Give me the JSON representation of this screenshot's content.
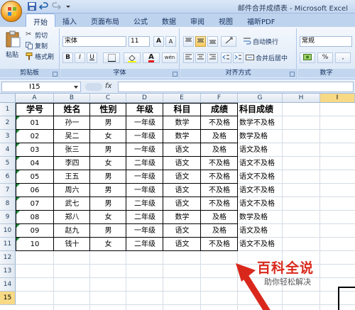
{
  "window": {
    "title": "邮件合并成绩表 - Microsoft Excel"
  },
  "ribbon": {
    "tabs": [
      "开始",
      "插入",
      "页面布局",
      "公式",
      "数据",
      "审阅",
      "视图",
      "福昕PDF"
    ],
    "active_tab": "开始",
    "clipboard": {
      "paste": "粘贴",
      "cut": "剪切",
      "copy": "复制",
      "format_painter": "格式刷",
      "label": "剪贴板"
    },
    "font": {
      "name": "宋体",
      "size": "11",
      "grow": "A",
      "shrink": "A",
      "bold": "B",
      "italic": "I",
      "underline": "U",
      "phonetic": "wén",
      "label": "字体"
    },
    "alignment": {
      "wrap_text": "自动换行",
      "merge_center": "合并后居中",
      "label": "对齐方式"
    },
    "number": {
      "format": "常规",
      "percent": "%",
      "comma": ",",
      "label": "数字"
    }
  },
  "formula_bar": {
    "name_box": "I15",
    "fx": "fx",
    "content": ""
  },
  "columns": [
    "A",
    "B",
    "C",
    "D",
    "E",
    "F",
    "G",
    "H",
    "I"
  ],
  "rows": [
    "1",
    "2",
    "3",
    "4",
    "5",
    "6",
    "7",
    "8",
    "9",
    "10",
    "11",
    "12",
    "13",
    "14",
    "15"
  ],
  "table": {
    "headers": [
      "学号",
      "姓名",
      "性别",
      "年级",
      "科目",
      "成绩",
      "科目成绩"
    ],
    "rows": [
      [
        "01",
        "孙一",
        "男",
        "一年级",
        "数学",
        "不及格",
        "数学不及格"
      ],
      [
        "02",
        "吴二",
        "女",
        "一年级",
        "数学",
        "及格",
        "数学及格"
      ],
      [
        "03",
        "张三",
        "男",
        "一年级",
        "语文",
        "及格",
        "语文及格"
      ],
      [
        "04",
        "李四",
        "女",
        "二年级",
        "语文",
        "不及格",
        "语文不及格"
      ],
      [
        "05",
        "王五",
        "男",
        "一年级",
        "语文",
        "不及格",
        "语文不及格"
      ],
      [
        "06",
        "周六",
        "男",
        "一年级",
        "语文",
        "不及格",
        "语文不及格"
      ],
      [
        "07",
        "武七",
        "男",
        "二年级",
        "语文",
        "不及格",
        "语文不及格"
      ],
      [
        "08",
        "郑八",
        "女",
        "二年级",
        "数学",
        "及格",
        "数学及格"
      ],
      [
        "09",
        "赵九",
        "男",
        "一年级",
        "语文",
        "及格",
        "语文及格"
      ],
      [
        "10",
        "钱十",
        "女",
        "二年级",
        "语文",
        "不及格",
        "语文不及格"
      ]
    ]
  },
  "watermark": {
    "main": "百科全说",
    "sub": "助你轻松解决"
  }
}
